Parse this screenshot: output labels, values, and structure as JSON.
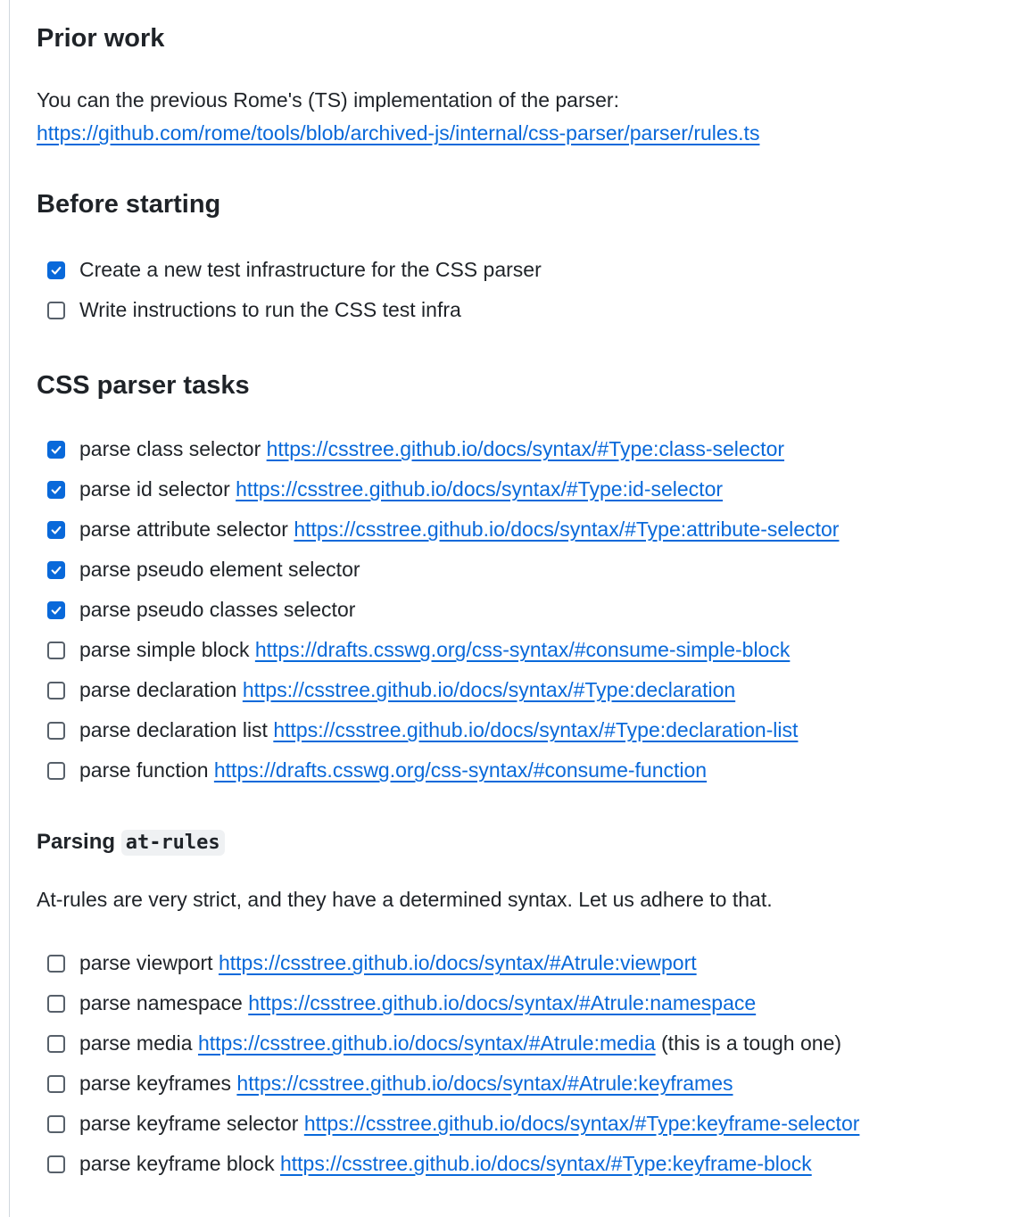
{
  "sections": {
    "prior_work": {
      "heading": "Prior work",
      "text": "You can the previous Rome's (TS) implementation of the parser:",
      "link": "https://github.com/rome/tools/blob/archived-js/internal/css-parser/parser/rules.ts"
    },
    "before_starting": {
      "heading": "Before starting",
      "tasks": [
        {
          "label": "Create a new test infrastructure for the CSS parser",
          "checked": true
        },
        {
          "label": "Write instructions to run the CSS test infra",
          "checked": false
        }
      ]
    },
    "css_parser_tasks": {
      "heading": "CSS parser tasks",
      "tasks": [
        {
          "label": "parse class selector",
          "link": "https://csstree.github.io/docs/syntax/#Type:class-selector",
          "checked": true
        },
        {
          "label": "parse id selector",
          "link": "https://csstree.github.io/docs/syntax/#Type:id-selector",
          "checked": true
        },
        {
          "label": "parse attribute selector",
          "link": "https://csstree.github.io/docs/syntax/#Type:attribute-selector",
          "checked": true
        },
        {
          "label": "parse pseudo element selector",
          "checked": true
        },
        {
          "label": "parse pseudo classes selector",
          "checked": true
        },
        {
          "label": "parse simple block",
          "link": "https://drafts.csswg.org/css-syntax/#consume-simple-block",
          "checked": false
        },
        {
          "label": "parse declaration",
          "link": "https://csstree.github.io/docs/syntax/#Type:declaration",
          "checked": false
        },
        {
          "label": "parse declaration list",
          "link": "https://csstree.github.io/docs/syntax/#Type:declaration-list",
          "checked": false
        },
        {
          "label": "parse function",
          "link": "https://drafts.csswg.org/css-syntax/#consume-function",
          "checked": false
        }
      ]
    },
    "at_rules": {
      "heading_prefix": "Parsing",
      "heading_code": "at-rules",
      "text": "At-rules are very strict, and they have a determined syntax. Let us adhere to that.",
      "tasks": [
        {
          "label": "parse viewport",
          "link": "https://csstree.github.io/docs/syntax/#Atrule:viewport",
          "checked": false
        },
        {
          "label": "parse namespace",
          "link": "https://csstree.github.io/docs/syntax/#Atrule:namespace",
          "checked": false
        },
        {
          "label": "parse media",
          "link": "https://csstree.github.io/docs/syntax/#Atrule:media",
          "suffix": "(this is a tough one)",
          "checked": false
        },
        {
          "label": "parse keyframes",
          "link": "https://csstree.github.io/docs/syntax/#Atrule:keyframes",
          "checked": false
        },
        {
          "label": "parse keyframe selector",
          "link": "https://csstree.github.io/docs/syntax/#Type:keyframe-selector",
          "checked": false
        },
        {
          "label": "parse keyframe block",
          "link": "https://csstree.github.io/docs/syntax/#Type:keyframe-block",
          "checked": false
        }
      ]
    }
  },
  "colors": {
    "link": "#0969da",
    "checkbox_checked": "#0969da",
    "text": "#1f2328"
  }
}
